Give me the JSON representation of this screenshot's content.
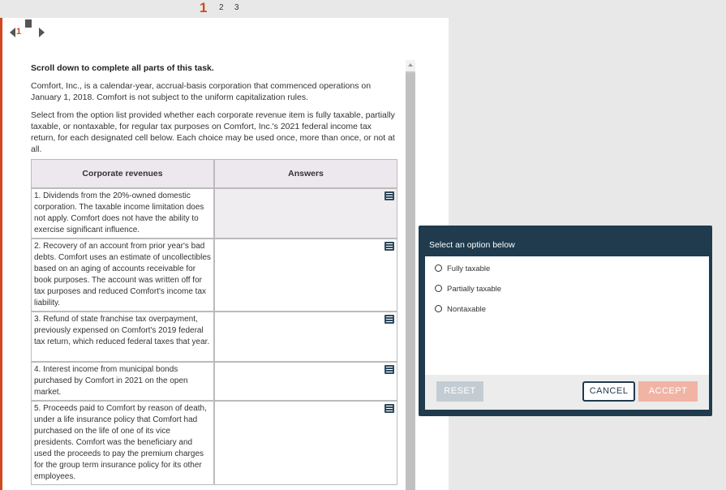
{
  "page_tabs": [
    {
      "label": "1"
    },
    {
      "label": "2"
    },
    {
      "label": "3"
    }
  ],
  "nav": {
    "page": "1"
  },
  "task": {
    "heading": "Scroll down to complete all parts of this task.",
    "paragraphs": [
      "Comfort, Inc., is a calendar-year, accrual-basis corporation that commenced operations on January 1, 2018. Comfort is not subject to the uniform capitalization rules.",
      "Select from the option list provided whether each corporate revenue item is fully taxable, partially taxable, or nontaxable, for regular tax purposes on Comfort, Inc.'s 2021 federal income tax return, for each designated cell below. Each choice may be used once, more than once, or not at all."
    ]
  },
  "table": {
    "headers": [
      "Corporate revenues",
      "Answers"
    ],
    "rows": [
      {
        "revenue": "1. Dividends from the 20%-owned domestic corporation. The taxable income limitation does not apply. Comfort does not have the ability to exercise significant influence.",
        "answer": ""
      },
      {
        "revenue": "2. Recovery of an account from prior year's bad debts. Comfort uses an estimate of uncollectibles based on an aging of accounts receivable for book purposes. The account was written off for tax purposes and reduced Comfort's income tax liability.",
        "answer": ""
      },
      {
        "revenue": "3. Refund of state franchise tax overpayment, previously expensed on Comfort's 2019 federal tax return, which reduced federal taxes that year.",
        "answer": ""
      },
      {
        "revenue": "4. Interest income from municipal bonds purchased by Comfort in 2021 on the open market.",
        "answer": ""
      },
      {
        "revenue": "5. Proceeds paid to Comfort by reason of death, under a life insurance policy that Comfort had purchased on the life of one of its vice presidents. Comfort was the beneficiary and used the proceeds to pay the premium charges for the group term insurance policy for its other employees.",
        "answer": ""
      }
    ]
  },
  "dialog": {
    "title": "Select an option below",
    "options": [
      "Fully taxable",
      "Partially taxable",
      "Nontaxable"
    ],
    "reset_label": "RESET",
    "cancel_label": "CANCEL",
    "accept_label": "ACCEPT"
  },
  "colors": {
    "accent": "#d04a1f",
    "dialog": "#1f3b4d",
    "accept_disabled": "#f1b4a4"
  }
}
